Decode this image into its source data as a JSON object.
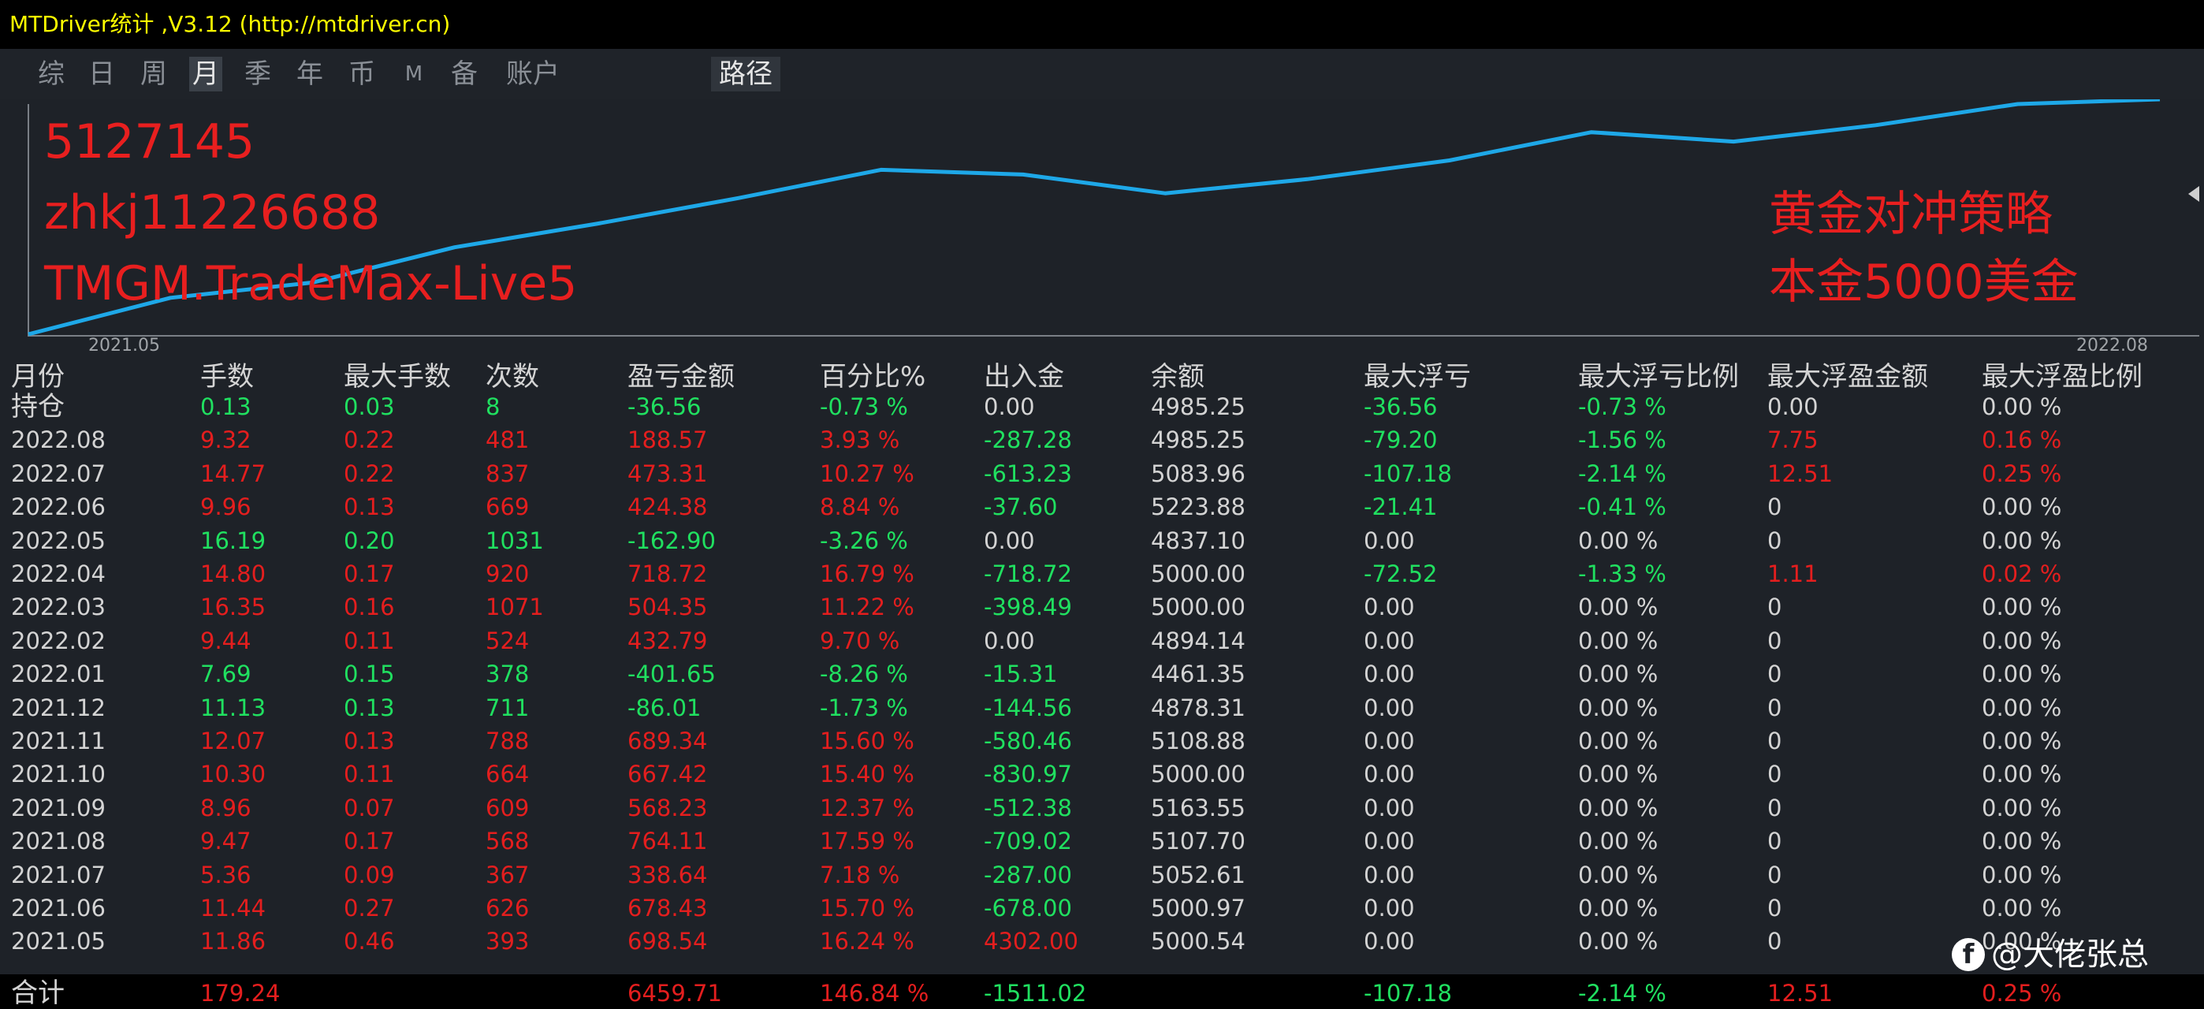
{
  "window": {
    "title": "MTDriver统计 ,V3.12 (http://mtdriver.cn)"
  },
  "tabs": [
    {
      "label": "综",
      "active": false
    },
    {
      "label": "日",
      "active": false
    },
    {
      "label": "周",
      "active": false
    },
    {
      "label": "月",
      "active": true
    },
    {
      "label": "季",
      "active": false
    },
    {
      "label": "年",
      "active": false
    },
    {
      "label": "币",
      "active": false
    },
    {
      "label": "M",
      "active": false
    },
    {
      "label": "备",
      "active": false
    },
    {
      "label": "账户",
      "active": false
    }
  ],
  "path_tab": "路径",
  "chart": {
    "account_lines": [
      "5127145",
      "zhkj11226688",
      "TMGM.TradeMax-Live5"
    ],
    "strategy_lines": [
      "黄金对冲策略",
      "本金5000美金"
    ],
    "start_label": "2021.05",
    "end_label": "2022.08",
    "line_color": "#1ea8e8",
    "text_color": "#e81f1f"
  },
  "chart_data": {
    "type": "line",
    "x": [
      "2021.05",
      "2021.06",
      "2021.07",
      "2021.08",
      "2021.09",
      "2021.10",
      "2021.11",
      "2021.12",
      "2022.01",
      "2022.02",
      "2022.03",
      "2022.04",
      "2022.05",
      "2022.06",
      "2022.07",
      "2022.08"
    ],
    "series": [
      {
        "values": [
          0,
          0.155,
          0.22,
          0.37,
          0.47,
          0.58,
          0.7,
          0.68,
          0.6,
          0.66,
          0.74,
          0.86,
          0.82,
          0.89,
          0.98,
          1.0
        ]
      }
    ],
    "xlabel": "",
    "ylabel": "",
    "grid": false
  },
  "table": {
    "headers": [
      "月份",
      "手数",
      "最大手数",
      "次数",
      "盈亏金额",
      "百分比%",
      "出入金",
      "余额",
      "最大浮亏",
      "最大浮亏比例",
      "最大浮盈金额",
      "最大浮盈比例"
    ],
    "rows": [
      {
        "label": "持仓",
        "cells": [
          "0.13",
          "0.03",
          "8",
          "-36.56",
          "-0.73 %",
          "0.00",
          "4985.25",
          "-36.56",
          "-0.73 %",
          "0.00",
          "0.00 %"
        ],
        "colors": [
          "g",
          "g",
          "g",
          "g",
          "g",
          "w",
          "w",
          "g",
          "g",
          "w",
          "w"
        ]
      },
      {
        "label": "2022.08",
        "cells": [
          "9.32",
          "0.22",
          "481",
          "188.57",
          "3.93 %",
          "-287.28",
          "4985.25",
          "-79.20",
          "-1.56 %",
          "7.75",
          "0.16 %"
        ],
        "colors": [
          "r",
          "r",
          "r",
          "r",
          "r",
          "g",
          "w",
          "g",
          "g",
          "r",
          "r"
        ]
      },
      {
        "label": "2022.07",
        "cells": [
          "14.77",
          "0.22",
          "837",
          "473.31",
          "10.27 %",
          "-613.23",
          "5083.96",
          "-107.18",
          "-2.14 %",
          "12.51",
          "0.25 %"
        ],
        "colors": [
          "r",
          "r",
          "r",
          "r",
          "r",
          "g",
          "w",
          "g",
          "g",
          "r",
          "r"
        ]
      },
      {
        "label": "2022.06",
        "cells": [
          "9.96",
          "0.13",
          "669",
          "424.38",
          "8.84 %",
          "-37.60",
          "5223.88",
          "-21.41",
          "-0.41 %",
          "0",
          "0.00 %"
        ],
        "colors": [
          "r",
          "r",
          "r",
          "r",
          "r",
          "g",
          "w",
          "g",
          "g",
          "w",
          "w"
        ]
      },
      {
        "label": "2022.05",
        "cells": [
          "16.19",
          "0.20",
          "1031",
          "-162.90",
          "-3.26 %",
          "0.00",
          "4837.10",
          "0.00",
          "0.00 %",
          "0",
          "0.00 %"
        ],
        "colors": [
          "g",
          "g",
          "g",
          "g",
          "g",
          "w",
          "w",
          "w",
          "w",
          "w",
          "w"
        ]
      },
      {
        "label": "2022.04",
        "cells": [
          "14.80",
          "0.17",
          "920",
          "718.72",
          "16.79 %",
          "-718.72",
          "5000.00",
          "-72.52",
          "-1.33 %",
          "1.11",
          "0.02 %"
        ],
        "colors": [
          "r",
          "r",
          "r",
          "r",
          "r",
          "g",
          "w",
          "g",
          "g",
          "r",
          "r"
        ]
      },
      {
        "label": "2022.03",
        "cells": [
          "16.35",
          "0.16",
          "1071",
          "504.35",
          "11.22 %",
          "-398.49",
          "5000.00",
          "0.00",
          "0.00 %",
          "0",
          "0.00 %"
        ],
        "colors": [
          "r",
          "r",
          "r",
          "r",
          "r",
          "g",
          "w",
          "w",
          "w",
          "w",
          "w"
        ]
      },
      {
        "label": "2022.02",
        "cells": [
          "9.44",
          "0.11",
          "524",
          "432.79",
          "9.70 %",
          "0.00",
          "4894.14",
          "0.00",
          "0.00 %",
          "0",
          "0.00 %"
        ],
        "colors": [
          "r",
          "r",
          "r",
          "r",
          "r",
          "w",
          "w",
          "w",
          "w",
          "w",
          "w"
        ]
      },
      {
        "label": "2022.01",
        "cells": [
          "7.69",
          "0.15",
          "378",
          "-401.65",
          "-8.26 %",
          "-15.31",
          "4461.35",
          "0.00",
          "0.00 %",
          "0",
          "0.00 %"
        ],
        "colors": [
          "g",
          "g",
          "g",
          "g",
          "g",
          "g",
          "w",
          "w",
          "w",
          "w",
          "w"
        ]
      },
      {
        "label": "2021.12",
        "cells": [
          "11.13",
          "0.13",
          "711",
          "-86.01",
          "-1.73 %",
          "-144.56",
          "4878.31",
          "0.00",
          "0.00 %",
          "0",
          "0.00 %"
        ],
        "colors": [
          "g",
          "g",
          "g",
          "g",
          "g",
          "g",
          "w",
          "w",
          "w",
          "w",
          "w"
        ]
      },
      {
        "label": "2021.11",
        "cells": [
          "12.07",
          "0.13",
          "788",
          "689.34",
          "15.60 %",
          "-580.46",
          "5108.88",
          "0.00",
          "0.00 %",
          "0",
          "0.00 %"
        ],
        "colors": [
          "r",
          "r",
          "r",
          "r",
          "r",
          "g",
          "w",
          "w",
          "w",
          "w",
          "w"
        ]
      },
      {
        "label": "2021.10",
        "cells": [
          "10.30",
          "0.11",
          "664",
          "667.42",
          "15.40 %",
          "-830.97",
          "5000.00",
          "0.00",
          "0.00 %",
          "0",
          "0.00 %"
        ],
        "colors": [
          "r",
          "r",
          "r",
          "r",
          "r",
          "g",
          "w",
          "w",
          "w",
          "w",
          "w"
        ]
      },
      {
        "label": "2021.09",
        "cells": [
          "8.96",
          "0.07",
          "609",
          "568.23",
          "12.37 %",
          "-512.38",
          "5163.55",
          "0.00",
          "0.00 %",
          "0",
          "0.00 %"
        ],
        "colors": [
          "r",
          "r",
          "r",
          "r",
          "r",
          "g",
          "w",
          "w",
          "w",
          "w",
          "w"
        ]
      },
      {
        "label": "2021.08",
        "cells": [
          "9.47",
          "0.17",
          "568",
          "764.11",
          "17.59 %",
          "-709.02",
          "5107.70",
          "0.00",
          "0.00 %",
          "0",
          "0.00 %"
        ],
        "colors": [
          "r",
          "r",
          "r",
          "r",
          "r",
          "g",
          "w",
          "w",
          "w",
          "w",
          "w"
        ]
      },
      {
        "label": "2021.07",
        "cells": [
          "5.36",
          "0.09",
          "367",
          "338.64",
          "7.18 %",
          "-287.00",
          "5052.61",
          "0.00",
          "0.00 %",
          "0",
          "0.00 %"
        ],
        "colors": [
          "r",
          "r",
          "r",
          "r",
          "r",
          "g",
          "w",
          "w",
          "w",
          "w",
          "w"
        ]
      },
      {
        "label": "2021.06",
        "cells": [
          "11.44",
          "0.27",
          "626",
          "678.43",
          "15.70 %",
          "-678.00",
          "5000.97",
          "0.00",
          "0.00 %",
          "0",
          "0.00 %"
        ],
        "colors": [
          "r",
          "r",
          "r",
          "r",
          "r",
          "g",
          "w",
          "w",
          "w",
          "w",
          "w"
        ]
      },
      {
        "label": "2021.05",
        "cells": [
          "11.86",
          "0.46",
          "393",
          "698.54",
          "16.24 %",
          "4302.00",
          "5000.54",
          "0.00",
          "0.00 %",
          "0",
          "0.00 %"
        ],
        "colors": [
          "r",
          "r",
          "r",
          "r",
          "r",
          "r",
          "w",
          "w",
          "w",
          "w",
          "w"
        ]
      }
    ],
    "total": {
      "label": "合计",
      "cells": [
        "179.24",
        "",
        "",
        "6459.71",
        "146.84 %",
        "-1511.02",
        "",
        "-107.18",
        "-2.14 %",
        "12.51",
        "0.25 %"
      ],
      "colors": [
        "r",
        "r",
        "r",
        "r",
        "r",
        "g",
        "w",
        "g",
        "g",
        "r",
        "r"
      ]
    }
  },
  "watermark": {
    "logo": "f",
    "text": "@大佬张总"
  }
}
